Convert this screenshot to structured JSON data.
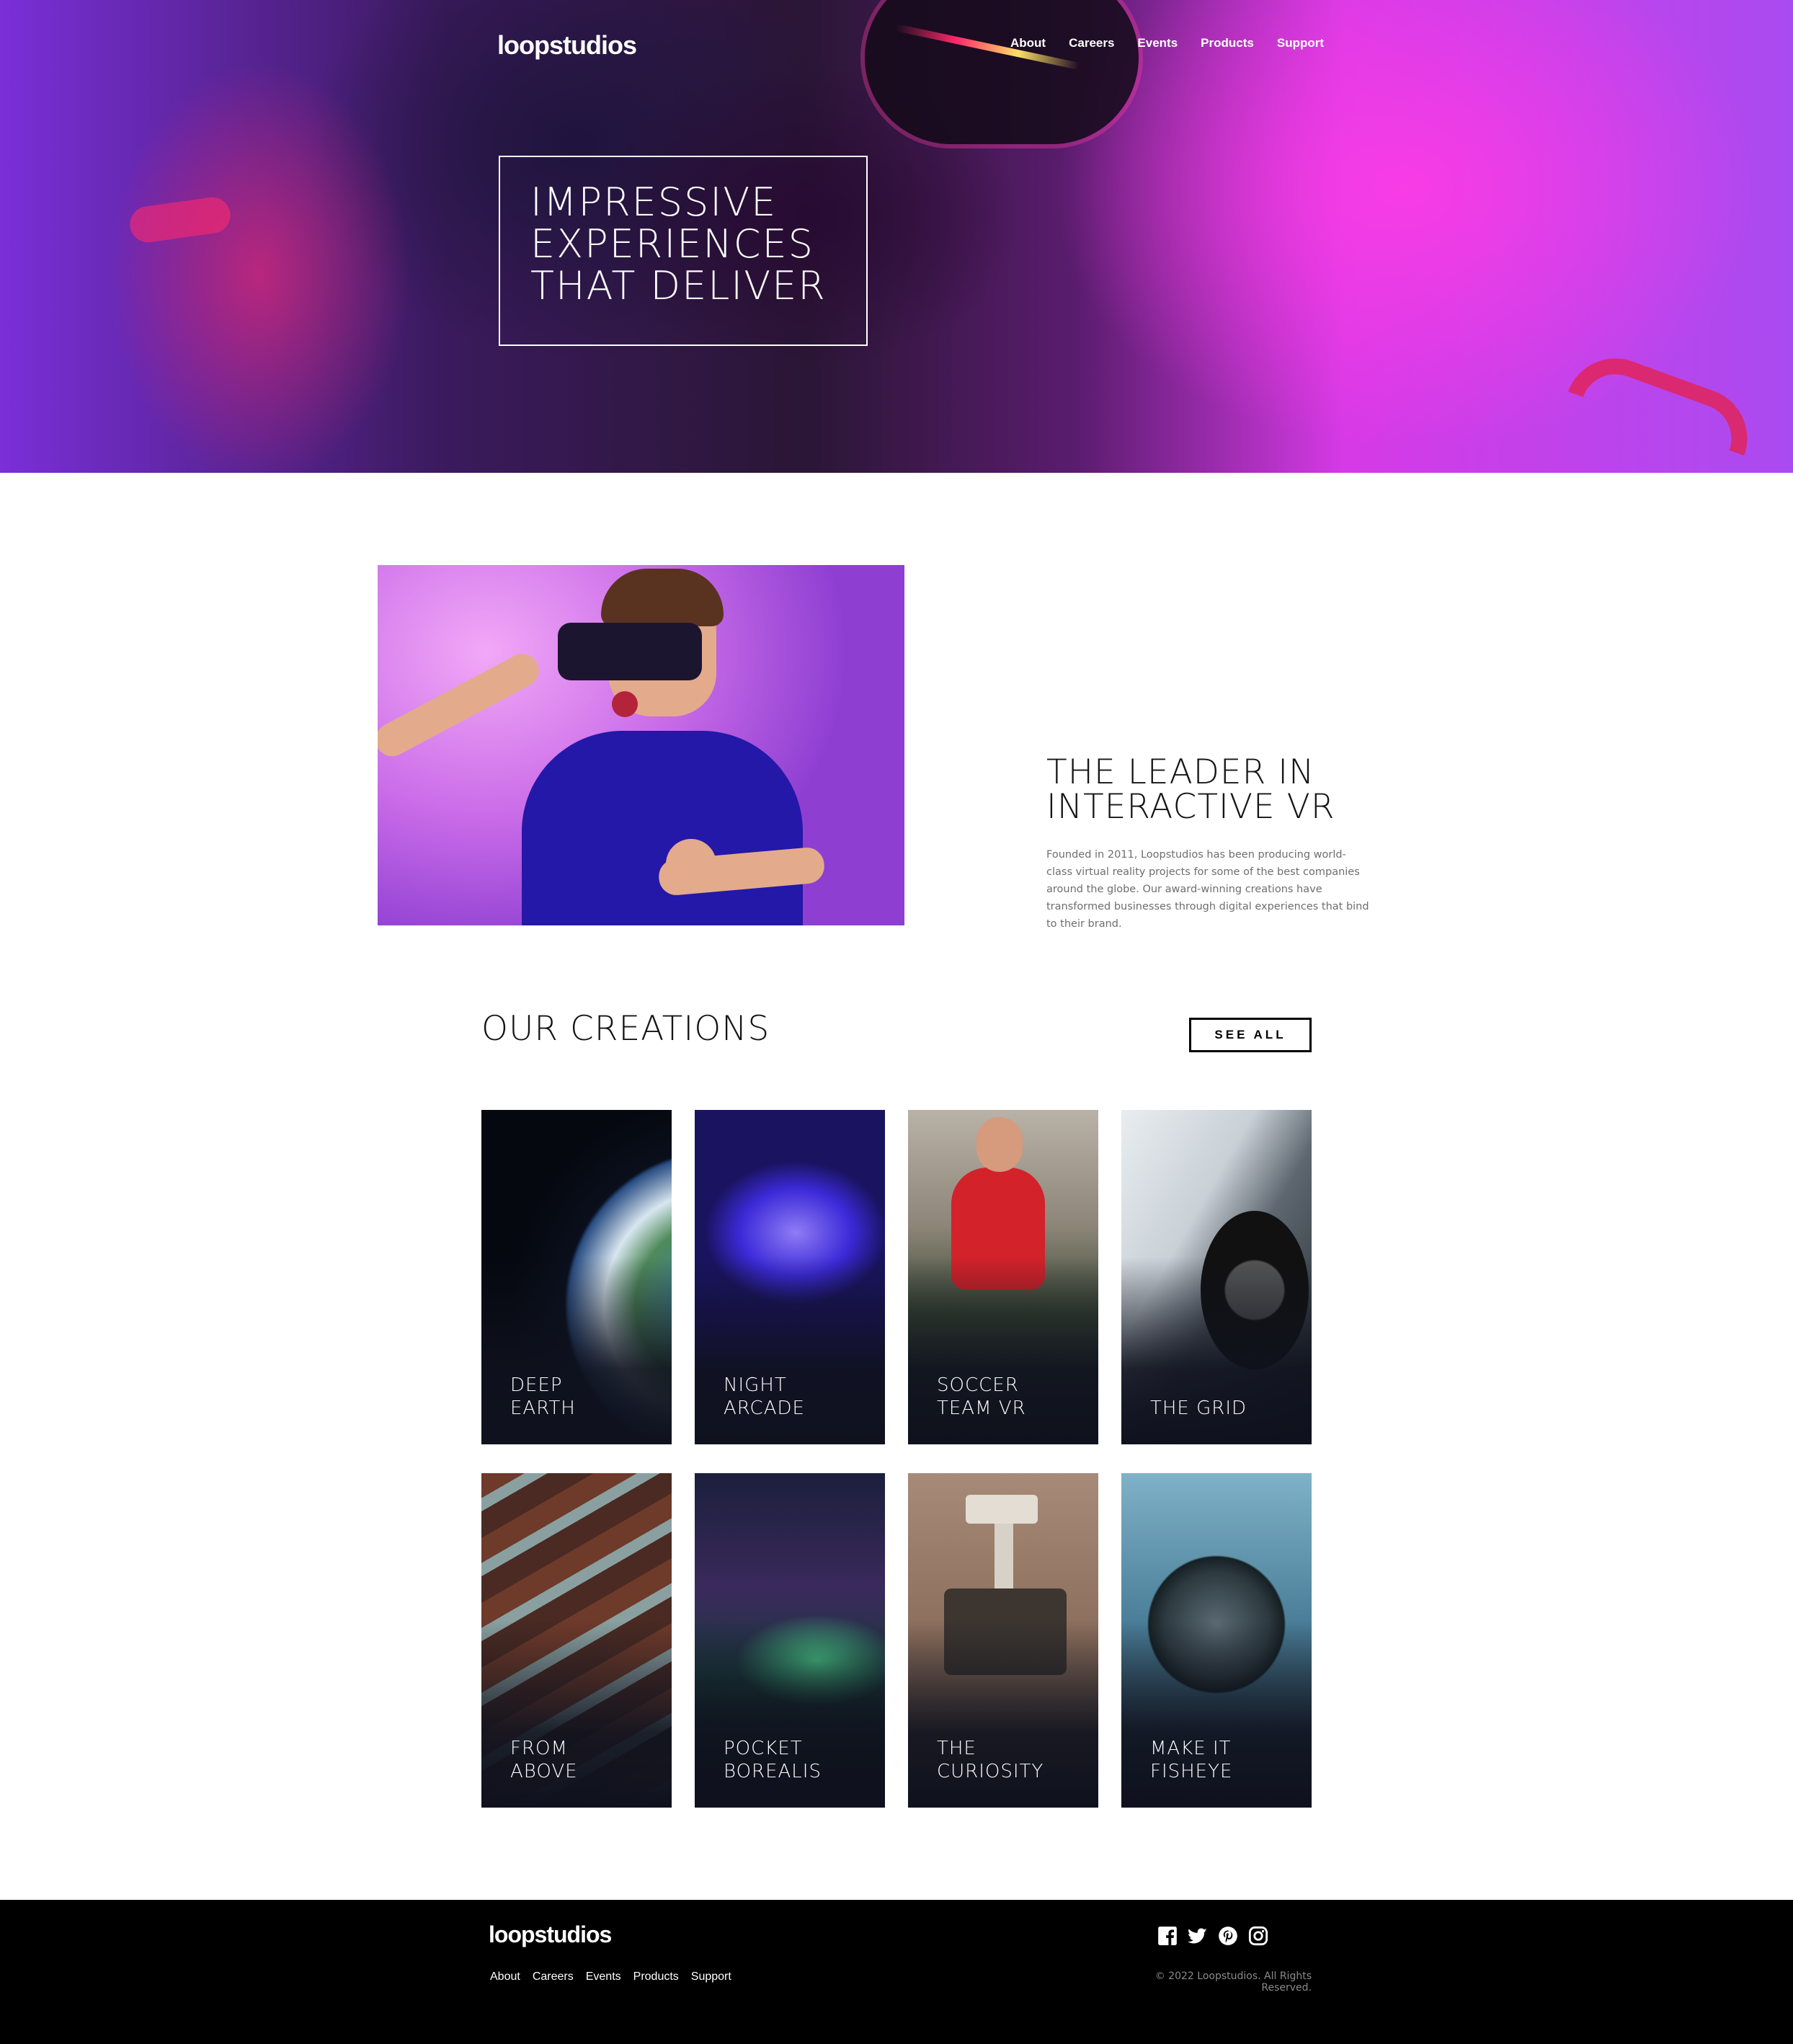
{
  "header": {
    "logo": "loopstudios",
    "nav": [
      "About",
      "Careers",
      "Events",
      "Products",
      "Support"
    ]
  },
  "hero": {
    "title": "IMPRESSIVE\nEXPERIENCES\nTHAT DELIVER"
  },
  "about": {
    "title": "THE LEADER IN\nINTERACTIVE VR",
    "text": "Founded in 2011, Loopstudios has been producing world-class virtual reality projects for some of the best companies around the globe. Our award-winning creations have transformed businesses through digital experiences that bind to their brand."
  },
  "creations": {
    "title": "OUR CREATIONS",
    "see_all": "SEE ALL",
    "items": [
      {
        "label": "DEEP\nEARTH"
      },
      {
        "label": "NIGHT\nARCADE"
      },
      {
        "label": "SOCCER\nTEAM VR"
      },
      {
        "label": "THE GRID"
      },
      {
        "label": "FROM\nABOVE"
      },
      {
        "label": "POCKET\nBOREALIS"
      },
      {
        "label": "THE\nCURIOSITY"
      },
      {
        "label": "MAKE IT\nFISHEYE"
      }
    ]
  },
  "footer": {
    "logo": "loopstudios",
    "nav": [
      "About",
      "Careers",
      "Events",
      "Products",
      "Support"
    ],
    "social_icons": [
      "facebook-icon",
      "twitter-icon",
      "pinterest-icon",
      "instagram-icon"
    ],
    "copyright": "© 2022 Loopstudios. All Rights Reserved."
  }
}
